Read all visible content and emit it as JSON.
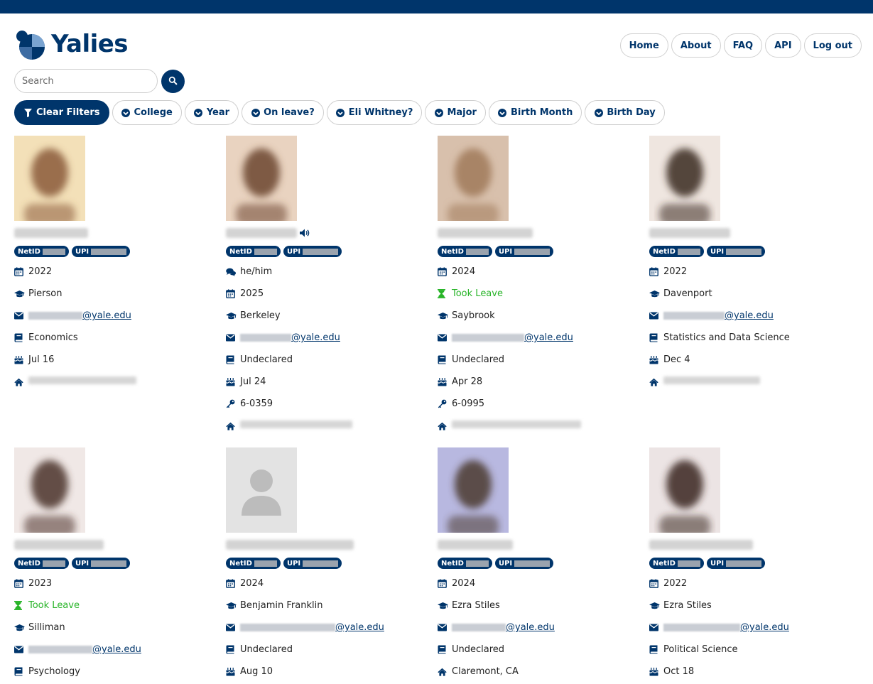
{
  "app": {
    "logo_text": "Yalies"
  },
  "nav": {
    "home": "Home",
    "about": "About",
    "faq": "FAQ",
    "api": "API",
    "logout": "Log out"
  },
  "search": {
    "placeholder": "Search"
  },
  "filters": {
    "clear": "Clear Filters",
    "college": "College",
    "year": "Year",
    "on_leave": "On leave?",
    "eli_whitney": "Eli Whitney?",
    "major": "Major",
    "birth_month": "Birth Month",
    "birth_day": "Birth Day"
  },
  "colors": {
    "brand": "#00356b",
    "leave": "#28b428"
  },
  "badge_labels": {
    "netid": "NetID",
    "upi": "UPI"
  },
  "email_domain": "@yale.edu",
  "people": [
    {
      "rows": [
        {
          "icon": "calendar-icon",
          "text": "2022"
        },
        {
          "icon": "graduation-cap-icon",
          "text": "Pierson"
        },
        {
          "icon": "envelope-icon",
          "text": "@yale.edu",
          "type": "email"
        },
        {
          "icon": "book-icon",
          "text": "Economics"
        },
        {
          "icon": "birthday-cake-icon",
          "text": "Jul 16"
        },
        {
          "icon": "home-icon",
          "text": "",
          "type": "address"
        }
      ]
    },
    {
      "audio": true,
      "rows": [
        {
          "icon": "comments-icon",
          "text": "he/him"
        },
        {
          "icon": "calendar-icon",
          "text": "2025"
        },
        {
          "icon": "graduation-cap-icon",
          "text": "Berkeley"
        },
        {
          "icon": "envelope-icon",
          "text": "@yale.edu",
          "type": "email"
        },
        {
          "icon": "book-icon",
          "text": "Undeclared"
        },
        {
          "icon": "birthday-cake-icon",
          "text": "Jul 24"
        },
        {
          "icon": "key-icon",
          "text": "6-0359"
        },
        {
          "icon": "home-icon",
          "text": "",
          "type": "address"
        }
      ]
    },
    {
      "rows": [
        {
          "icon": "calendar-icon",
          "text": "2024"
        },
        {
          "icon": "hourglass-icon",
          "text": "Took Leave",
          "type": "leave"
        },
        {
          "icon": "graduation-cap-icon",
          "text": "Saybrook"
        },
        {
          "icon": "envelope-icon",
          "text": "@yale.edu",
          "type": "email"
        },
        {
          "icon": "book-icon",
          "text": "Undeclared"
        },
        {
          "icon": "birthday-cake-icon",
          "text": "Apr 28"
        },
        {
          "icon": "key-icon",
          "text": "6-0995"
        },
        {
          "icon": "home-icon",
          "text": "",
          "type": "address"
        }
      ]
    },
    {
      "rows": [
        {
          "icon": "calendar-icon",
          "text": "2022"
        },
        {
          "icon": "graduation-cap-icon",
          "text": "Davenport"
        },
        {
          "icon": "envelope-icon",
          "text": "@yale.edu",
          "type": "email"
        },
        {
          "icon": "book-icon",
          "text": "Statistics and Data Science"
        },
        {
          "icon": "birthday-cake-icon",
          "text": "Dec 4"
        },
        {
          "icon": "home-icon",
          "text": "",
          "type": "address"
        }
      ]
    },
    {
      "rows": [
        {
          "icon": "calendar-icon",
          "text": "2023"
        },
        {
          "icon": "hourglass-icon",
          "text": "Took Leave",
          "type": "leave"
        },
        {
          "icon": "graduation-cap-icon",
          "text": "Silliman"
        },
        {
          "icon": "envelope-icon",
          "text": "@yale.edu",
          "type": "email"
        },
        {
          "icon": "book-icon",
          "text": "Psychology"
        }
      ]
    },
    {
      "placeholder_photo": true,
      "rows": [
        {
          "icon": "calendar-icon",
          "text": "2024"
        },
        {
          "icon": "graduation-cap-icon",
          "text": "Benjamin Franklin"
        },
        {
          "icon": "envelope-icon",
          "text": "@yale.edu",
          "type": "email"
        },
        {
          "icon": "book-icon",
          "text": "Undeclared"
        },
        {
          "icon": "birthday-cake-icon",
          "text": "Aug 10"
        }
      ]
    },
    {
      "rows": [
        {
          "icon": "calendar-icon",
          "text": "2024"
        },
        {
          "icon": "graduation-cap-icon",
          "text": "Ezra Stiles"
        },
        {
          "icon": "envelope-icon",
          "text": "@yale.edu",
          "type": "email"
        },
        {
          "icon": "book-icon",
          "text": "Undeclared"
        },
        {
          "icon": "home-icon",
          "text": "Claremont, CA"
        }
      ]
    },
    {
      "rows": [
        {
          "icon": "calendar-icon",
          "text": "2022"
        },
        {
          "icon": "graduation-cap-icon",
          "text": "Ezra Stiles"
        },
        {
          "icon": "envelope-icon",
          "text": "@yale.edu",
          "type": "email"
        },
        {
          "icon": "book-icon",
          "text": "Political Science"
        },
        {
          "icon": "birthday-cake-icon",
          "text": "Oct 18"
        }
      ]
    }
  ]
}
